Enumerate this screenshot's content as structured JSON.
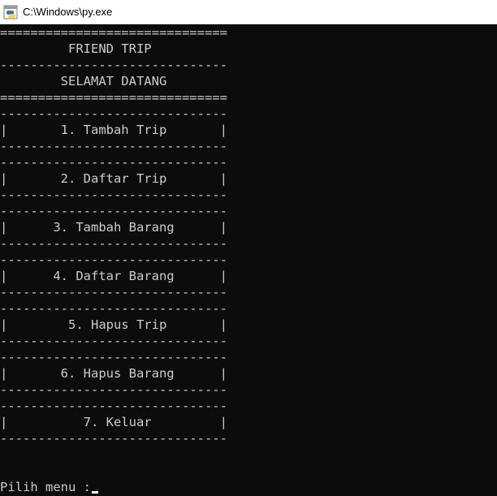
{
  "window": {
    "title": "C:\\Windows\\py.exe",
    "icon": "python-icon"
  },
  "console": {
    "lines": [
      "==============================",
      "         FRIEND TRIP",
      "------------------------------",
      "        SELAMAT DATANG",
      "==============================",
      "------------------------------",
      "|       1. Tambah Trip       |",
      "------------------------------",
      "------------------------------",
      "|       2. Daftar Trip       |",
      "------------------------------",
      "------------------------------",
      "|      3. Tambah Barang      |",
      "------------------------------",
      "------------------------------",
      "|      4. Daftar Barang      |",
      "------------------------------",
      "------------------------------",
      "|        5. Hapus Trip       |",
      "------------------------------",
      "------------------------------",
      "|       6. Hapus Barang      |",
      "------------------------------",
      "------------------------------",
      "|          7. Keluar         |",
      "------------------------------",
      "",
      ""
    ],
    "prompt": "Pilih menu :"
  }
}
